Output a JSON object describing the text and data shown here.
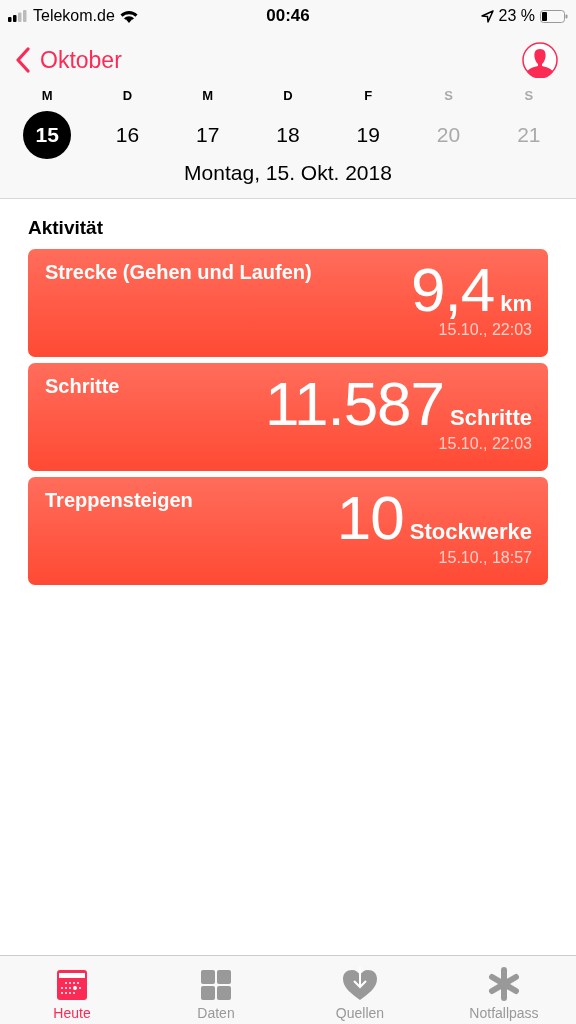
{
  "status_bar": {
    "carrier": "Telekom.de",
    "time": "00:46",
    "battery": "23 %"
  },
  "nav": {
    "back": "Oktober"
  },
  "week": [
    {
      "weekday": "M",
      "day": "15",
      "selected": true,
      "dimmed": false
    },
    {
      "weekday": "D",
      "day": "16",
      "selected": false,
      "dimmed": false
    },
    {
      "weekday": "M",
      "day": "17",
      "selected": false,
      "dimmed": false
    },
    {
      "weekday": "D",
      "day": "18",
      "selected": false,
      "dimmed": false
    },
    {
      "weekday": "F",
      "day": "19",
      "selected": false,
      "dimmed": false
    },
    {
      "weekday": "S",
      "day": "20",
      "selected": false,
      "dimmed": true
    },
    {
      "weekday": "S",
      "day": "21",
      "selected": false,
      "dimmed": true
    }
  ],
  "date": "Montag, 15. Okt. 2018",
  "section": "Aktivität",
  "cards": [
    {
      "title": "Strecke (Gehen und Laufen)",
      "value": "9,4",
      "unit": "km",
      "time": "15.10., 22:03"
    },
    {
      "title": "Schritte",
      "value": "11.587",
      "unit": "Schritte",
      "time": "15.10., 22:03"
    },
    {
      "title": "Treppensteigen",
      "value": "10",
      "unit": "Stockwerke",
      "time": "15.10., 18:57"
    }
  ],
  "tabs": [
    {
      "kind": "today",
      "label": "Heute",
      "selected": true
    },
    {
      "kind": "data",
      "label": "Daten",
      "selected": false
    },
    {
      "kind": "sources",
      "label": "Quellen",
      "selected": false
    },
    {
      "kind": "emergency",
      "label": "Notfallpass",
      "selected": false
    }
  ]
}
